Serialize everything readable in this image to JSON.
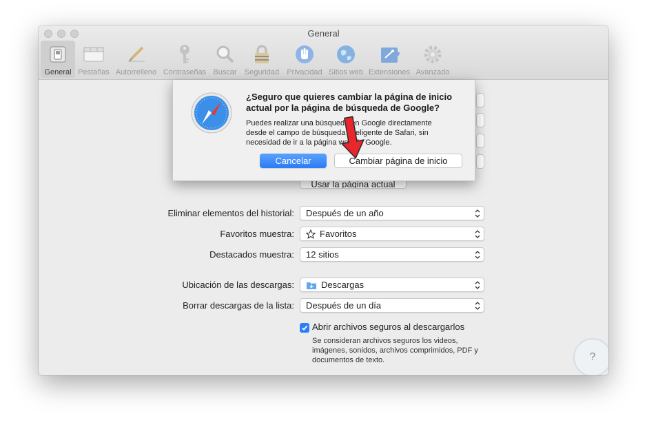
{
  "window": {
    "title": "General"
  },
  "toolbar": {
    "items": [
      {
        "label": "General",
        "icon": "general-switch-icon",
        "active": true
      },
      {
        "label": "Pestañas",
        "icon": "tabs-icon"
      },
      {
        "label": "Autorrelleno",
        "icon": "pencil-icon"
      },
      {
        "label": "Contraseñas",
        "icon": "key-icon"
      },
      {
        "label": "Buscar",
        "icon": "magnifier-icon"
      },
      {
        "label": "Seguridad",
        "icon": "lock-icon"
      },
      {
        "label": "Privacidad",
        "icon": "hand-icon"
      },
      {
        "label": "Sitios web",
        "icon": "globe-icon"
      },
      {
        "label": "Extensiones",
        "icon": "puzzle-icon"
      },
      {
        "label": "Avanzado",
        "icon": "gear-icon"
      }
    ]
  },
  "dialog": {
    "title": "¿Seguro que quieres cambiar la página de inicio actual por la página de búsqueda de Google?",
    "message": "Puedes realizar una búsqueda en Google directamente desde el campo de búsqueda inteligente de Safari, sin necesidad de ir a la página web de Google.",
    "cancel_label": "Cancelar",
    "confirm_label": "Cambiar página de inicio",
    "icon": "safari-compass-icon"
  },
  "settings": {
    "use_current_label": "Usar la página actual",
    "history": {
      "label": "Eliminar elementos del historial:",
      "value": "Después de un año"
    },
    "favorites": {
      "label": "Favoritos muestra:",
      "value": "Favoritos"
    },
    "top_sites": {
      "label": "Destacados muestra:",
      "value": "12 sitios"
    },
    "downloads_location": {
      "label": "Ubicación de las descargas:",
      "value": "Descargas"
    },
    "remove_downloads": {
      "label": "Borrar descargas de la lista:",
      "value": "Después de un día"
    },
    "open_safe_files": {
      "label": "Abrir archivos seguros al descargarlos",
      "checked": true,
      "help": "Se consideran archivos seguros los videos, imágenes, sonidos, archivos comprimidos, PDF y documentos de texto."
    }
  },
  "help_button": {
    "symbol": "?"
  },
  "colors": {
    "accent": "#2a7cf6",
    "arrow": "#e8262b"
  }
}
